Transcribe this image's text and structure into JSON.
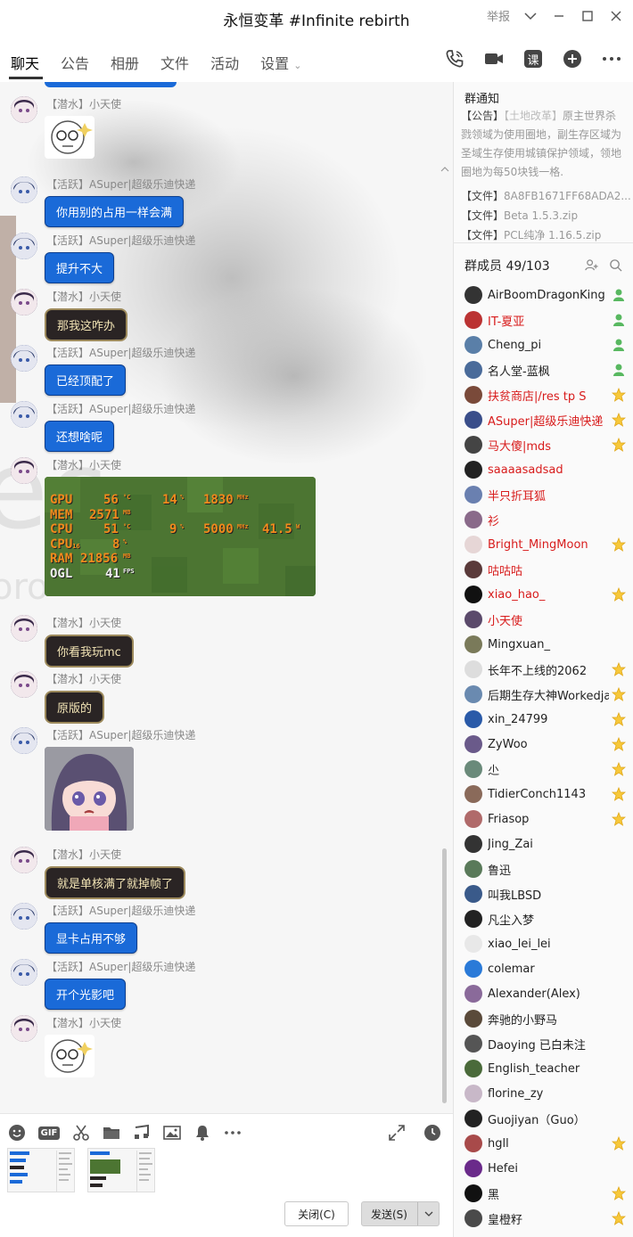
{
  "window": {
    "title": "永恒变革 #Infinite rebirth",
    "report_label": "举报"
  },
  "tabs": [
    {
      "label": "聊天"
    },
    {
      "label": "公告"
    },
    {
      "label": "相册"
    },
    {
      "label": "文件"
    },
    {
      "label": "活动"
    },
    {
      "label": "设置"
    }
  ],
  "tab_tools": {
    "course_label": "课"
  },
  "messages": [
    {
      "sender": "【潜水】小天使"
    },
    {
      "sender": "【活跃】ASuper|超级乐迪快递",
      "text": "你用别的占用一样会满"
    },
    {
      "sender": "【活跃】ASuper|超级乐迪快递",
      "text": "提升不大"
    },
    {
      "sender": "【潜水】小天使",
      "text": "那我这咋办"
    },
    {
      "sender": "【活跃】ASuper|超级乐迪快递",
      "text": "已经顶配了"
    },
    {
      "sender": "【活跃】ASuper|超级乐迪快递",
      "text": "还想啥呢"
    },
    {
      "sender": "【潜水】小天使"
    },
    {
      "sender": "【潜水】小天使",
      "text": "你看我玩mc"
    },
    {
      "sender": "【潜水】小天使",
      "text": "原版的"
    },
    {
      "sender": "【活跃】ASuper|超级乐迪快递"
    },
    {
      "sender": "【潜水】小天使",
      "text": "就是单核满了就掉帧了"
    },
    {
      "sender": "【活跃】ASuper|超级乐迪快递",
      "text": "显卡占用不够"
    },
    {
      "sender": "【活跃】ASuper|超级乐迪快递",
      "text": "开个光影吧"
    },
    {
      "sender": "【潜水】小天使"
    }
  ],
  "osd": {
    "gpu": {
      "label": "GPU",
      "temp": "56",
      "temp_unit": "°C",
      "load": "14",
      "load_unit": "%",
      "clock": "1830",
      "clock_unit": "MHz"
    },
    "mem": {
      "label": "MEM",
      "value": "2571",
      "unit": "MB"
    },
    "cpu": {
      "label": "CPU",
      "temp": "51",
      "temp_unit": "°C",
      "load": "9",
      "load_unit": "%",
      "clock": "5000",
      "clock_unit": "MHz",
      "power": "41.5",
      "power_unit": "W"
    },
    "cpu16": {
      "label": "CPU",
      "sub": "16",
      "value": "8",
      "unit": "%"
    },
    "ram": {
      "label": "RAM",
      "value": "21856",
      "unit": "MB"
    },
    "ogl": {
      "label": "OGL",
      "value": "41",
      "unit": "FPS"
    }
  },
  "buttons": {
    "close": "关闭(C)",
    "send": "发送(S)",
    "gif": "GIF"
  },
  "sidebar": {
    "notice_title": "群通知",
    "notice_tag": "【公告】",
    "notice_subtag": "【土地改革】",
    "notice_text": "原主世界杀戮领域为使用圈地，副生存区域为圣域生存使用城镇保护领域，领地圈地为每50块钱一格.",
    "files": [
      {
        "tag": "【文件】",
        "name": "8A8FB1671FF68ADA2..."
      },
      {
        "tag": "【文件】",
        "name": "Beta 1.5.3.zip"
      },
      {
        "tag": "【文件】",
        "name": "PCL纯净 1.16.5.zip"
      }
    ],
    "members_title": "群成员 49/103",
    "members": [
      {
        "name": "AirBoomDragonKing",
        "red": false,
        "badge": "admin",
        "color": "#333"
      },
      {
        "name": "IT-夏亚",
        "red": true,
        "badge": "admin",
        "color": "#b33"
      },
      {
        "name": "Cheng_pi",
        "red": false,
        "badge": "admin",
        "color": "#5a7fa8"
      },
      {
        "name": "名人堂-蓝枫",
        "red": false,
        "badge": "admin",
        "color": "#4a6b9a"
      },
      {
        "name": "扶贫商店|/res tp S",
        "red": true,
        "badge": "star",
        "color": "#7a4a3a"
      },
      {
        "name": "ASuper|超级乐迪快递",
        "red": true,
        "badge": "star",
        "color": "#3a4e8a"
      },
      {
        "name": "马大傻|mds",
        "red": true,
        "badge": "star",
        "color": "#444"
      },
      {
        "name": "saaaasadsad",
        "red": true,
        "badge": "",
        "color": "#222"
      },
      {
        "name": "半只折耳狐",
        "red": true,
        "badge": "",
        "color": "#6a80b0"
      },
      {
        "name": "衫",
        "red": true,
        "badge": "",
        "color": "#8a6a8a"
      },
      {
        "name": "Bright_MingMoon",
        "red": true,
        "badge": "star",
        "color": "#e6d6d6"
      },
      {
        "name": "咕咕咕",
        "red": true,
        "badge": "",
        "color": "#5a3a3a"
      },
      {
        "name": "xiao_hao_",
        "red": true,
        "badge": "star",
        "color": "#111"
      },
      {
        "name": "小天使",
        "red": true,
        "badge": "",
        "color": "#5b4a6b"
      },
      {
        "name": "Mingxuan_",
        "red": false,
        "badge": "",
        "color": "#7a7a5a"
      },
      {
        "name": "长年不上线的2062",
        "red": false,
        "badge": "star",
        "color": "#ddd"
      },
      {
        "name": "后期生存大神Workedja",
        "red": false,
        "badge": "star",
        "color": "#6a8ab0"
      },
      {
        "name": "xin_24799",
        "red": false,
        "badge": "star",
        "color": "#2a5aa8"
      },
      {
        "name": "ZyWoo",
        "red": false,
        "badge": "star",
        "color": "#6a5a8a"
      },
      {
        "name": "尐",
        "red": false,
        "badge": "star",
        "color": "#6a8a7a"
      },
      {
        "name": "TidierConch1143",
        "red": false,
        "badge": "star",
        "color": "#8a6a5a"
      },
      {
        "name": "Friasop",
        "red": false,
        "badge": "star",
        "color": "#b06a6a"
      },
      {
        "name": "Jing_Zai",
        "red": false,
        "badge": "",
        "color": "#333"
      },
      {
        "name": "鲁迅",
        "red": false,
        "badge": "",
        "color": "#5a7a5a"
      },
      {
        "name": "叫我LBSD",
        "red": false,
        "badge": "",
        "color": "#3a5a8a"
      },
      {
        "name": "凡尘入梦",
        "red": false,
        "badge": "",
        "color": "#222"
      },
      {
        "name": "xiao_lei_lei",
        "red": false,
        "badge": "",
        "color": "#e8e8e8"
      },
      {
        "name": "colemar",
        "red": false,
        "badge": "",
        "color": "#2a7ad8"
      },
      {
        "name": "Alexander(Alex)",
        "red": false,
        "badge": "",
        "color": "#8a6a9a"
      },
      {
        "name": "奔驰的小野马",
        "red": false,
        "badge": "",
        "color": "#5a4a3a"
      },
      {
        "name": "Daoying 已白未注",
        "red": false,
        "badge": "",
        "color": "#555"
      },
      {
        "name": "English_teacher",
        "red": false,
        "badge": "",
        "color": "#4a6a3a"
      },
      {
        "name": "florine_zy",
        "red": false,
        "badge": "",
        "color": "#c8b8c8"
      },
      {
        "name": "Guojiyan（Guo）",
        "red": false,
        "badge": "",
        "color": "#222"
      },
      {
        "name": "hgll",
        "red": false,
        "badge": "star",
        "color": "#a84a4a"
      },
      {
        "name": "Hefei",
        "red": false,
        "badge": "",
        "color": "#6a2a8a"
      },
      {
        "name": "黑",
        "red": false,
        "badge": "star",
        "color": "#111"
      },
      {
        "name": "皇橙籽",
        "red": false,
        "badge": "star",
        "color": "#4a4a4a"
      }
    ]
  }
}
